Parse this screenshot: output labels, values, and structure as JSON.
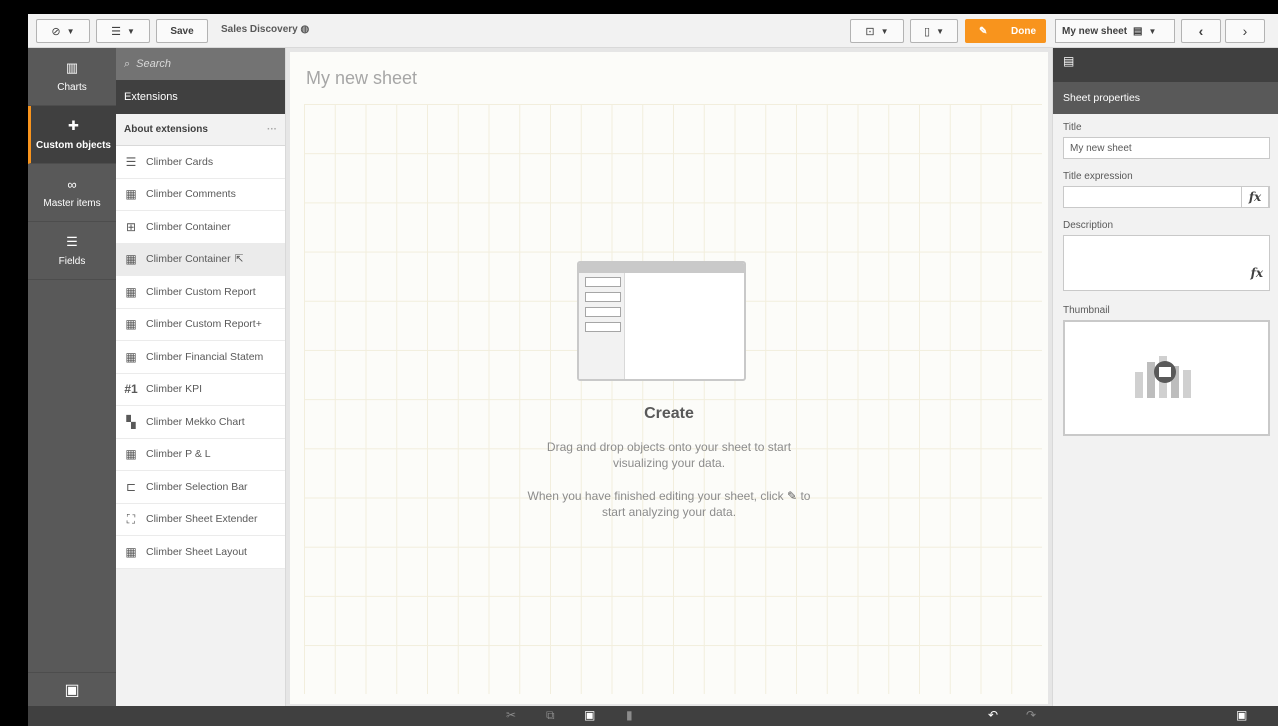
{
  "toolbar": {
    "nav_icon": "compass-icon",
    "list_icon": "list-icon",
    "save_label": "Save",
    "app_name": "Sales Discovery",
    "app_icon": "globe-icon",
    "present_icon": "present-icon",
    "bookmark_icon": "bookmark-icon",
    "done_label": "Done",
    "sheet_name": "My new sheet",
    "accent": "#f8941d"
  },
  "leftnav": {
    "items": [
      {
        "label": "Charts",
        "icon": "bar-chart-icon"
      },
      {
        "label": "Custom objects",
        "icon": "puzzle-icon"
      },
      {
        "label": "Master items",
        "icon": "link-icon"
      },
      {
        "label": "Fields",
        "icon": "database-icon"
      }
    ]
  },
  "panel": {
    "search_placeholder": "Search",
    "section": "Extensions",
    "about": "About extensions",
    "more": "···",
    "items": [
      {
        "label": "Climber Cards",
        "icon": "list-icon"
      },
      {
        "label": "Climber Comments",
        "icon": "table-icon"
      },
      {
        "label": "Climber Container",
        "icon": "container-icon"
      },
      {
        "label": "Climber Container",
        "icon": "grid-icon"
      },
      {
        "label": "Climber Custom Report",
        "icon": "table-icon"
      },
      {
        "label": "Climber Custom Report+",
        "icon": "table-plus-icon"
      },
      {
        "label": "Climber Financial Statem",
        "icon": "table-plus-icon"
      },
      {
        "label": "Climber KPI",
        "icon": "kpi-icon"
      },
      {
        "label": "Climber Mekko Chart",
        "icon": "mekko-icon"
      },
      {
        "label": "Climber P & L",
        "icon": "table-plus-icon"
      },
      {
        "label": "Climber Selection Bar",
        "icon": "filter-icon"
      },
      {
        "label": "Climber Sheet Extender",
        "icon": "expand-icon"
      },
      {
        "label": "Climber Sheet Layout",
        "icon": "table-icon"
      }
    ]
  },
  "canvas": {
    "sheet_title": "My new sheet",
    "create_title": "Create",
    "line1": "Drag and drop objects onto your sheet to start",
    "line2": "visualizing your data.",
    "line3": "When you have finished editing your sheet, click",
    "line3b": "to",
    "line4": "start analyzing your data."
  },
  "properties": {
    "header": "Sheet properties",
    "title_label": "Title",
    "title_value": "My new sheet",
    "title_expr_label": "Title expression",
    "fx": "fx",
    "description_label": "Description",
    "thumbnail_label": "Thumbnail"
  }
}
